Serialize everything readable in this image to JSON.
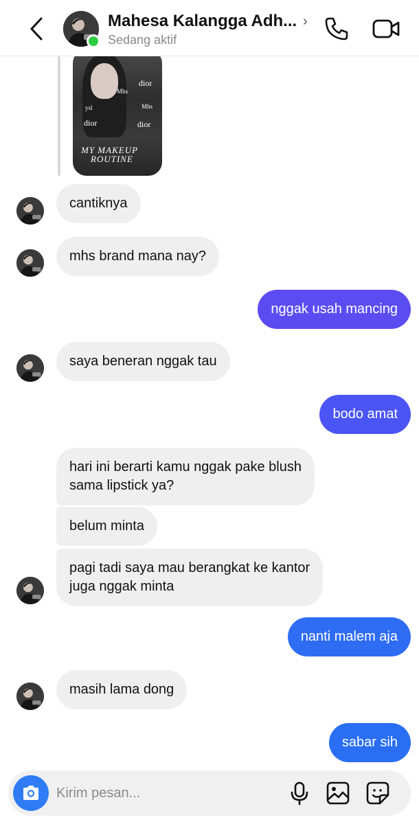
{
  "header": {
    "contact_name": "Mahesa Kalangga Adh...",
    "status": "Sedang aktif",
    "icons": [
      "back-chevron-icon",
      "phone-icon",
      "video-camera-icon"
    ]
  },
  "shared_post": {
    "labels": [
      "dior",
      "Mhs",
      "ysl",
      "dior",
      "dior",
      "Mhs",
      "dior"
    ],
    "title_line1": "MY MAKEUP",
    "title_line2": "ROUTINE"
  },
  "messages": [
    {
      "id": "m1",
      "side": "in",
      "text": "cantiknya"
    },
    {
      "id": "m2",
      "side": "in",
      "text": "mhs brand mana nay?"
    },
    {
      "id": "m3",
      "side": "out",
      "text": "nggak usah mancing"
    },
    {
      "id": "m4",
      "side": "in",
      "text": "saya beneran nggak tau"
    },
    {
      "id": "m5",
      "side": "out",
      "text": "bodo amat"
    },
    {
      "id": "m6",
      "side": "in",
      "line1": "hari ini berarti kamu nggak pake blush",
      "line2": "sama lipstick ya?"
    },
    {
      "id": "m7",
      "side": "in",
      "text": "belum minta"
    },
    {
      "id": "m8",
      "side": "in",
      "line1": "pagi tadi saya mau berangkat ke kantor",
      "line2": "juga nggak minta"
    },
    {
      "id": "m9",
      "side": "out",
      "text": "nanti malem aja"
    },
    {
      "id": "m10",
      "side": "in",
      "text": "masih lama dong"
    },
    {
      "id": "m11",
      "side": "out",
      "text": "sabar sih"
    }
  ],
  "composer": {
    "placeholder": "Kirim pesan...",
    "icons": [
      "camera-icon",
      "microphone-icon",
      "gallery-icon",
      "sticker-icon"
    ]
  },
  "colors": {
    "out_purple": "#5b4cf2",
    "out_mid": "#4b55f5",
    "out_blue": "#2a6ff3",
    "in_bubble": "#efefef",
    "online": "#2ecc40",
    "camera_button": "#2f7cf6"
  }
}
